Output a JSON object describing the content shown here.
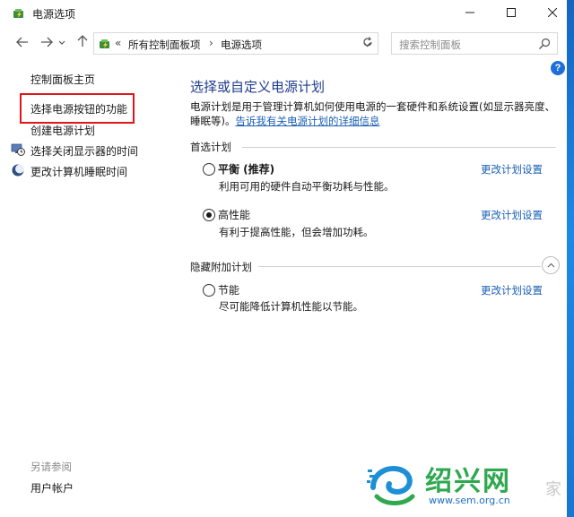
{
  "window": {
    "title": "电源选项",
    "minimize_icon": "minimize-icon",
    "maximize_icon": "maximize-icon",
    "close_icon": "close-icon"
  },
  "navigation": {
    "back_icon": "arrow-left-icon",
    "forward_icon": "arrow-right-icon",
    "recent_icon": "chevron-down-icon",
    "up_icon": "arrow-up-icon",
    "address": {
      "separator": "«",
      "crumbs": [
        "所有控制面板项",
        "电源选项"
      ],
      "crumb_separator": "›"
    },
    "refresh_icon": "refresh-icon",
    "search": {
      "placeholder": "搜索控制面板"
    }
  },
  "help_label": "?",
  "sidebar": {
    "home": "控制面板主页",
    "items": [
      {
        "label": "选择电源按钮的功能",
        "highlighted": true
      },
      {
        "label": "创建电源计划"
      },
      {
        "label": "选择关闭显示器的时间",
        "icon": "display-clock-icon"
      },
      {
        "label": "更改计算机睡眠时间",
        "icon": "moon-icon"
      }
    ],
    "see_also": "另请参阅",
    "user_accounts": "用户帐户"
  },
  "main": {
    "title": "选择或自定义电源计划",
    "description": "电源计划是用于管理计算机如何使用电源的一套硬件和系统设置(如显示器亮度、睡眠等)。",
    "description_link": "告诉我有关电源计划的详细信息",
    "preferred_label": "首选计划",
    "hidden_label": "隐藏附加计划",
    "plans": [
      {
        "name": "平衡 (推荐)",
        "description": "利用可用的硬件自动平衡功耗与性能。",
        "link": "更改计划设置",
        "selected": false
      },
      {
        "name": "高性能",
        "description": "有利于提高性能，但会增加功耗。",
        "link": "更改计划设置",
        "selected": true
      },
      {
        "name": "节能",
        "description": "尽可能降低计算机性能以节能。",
        "link": "更改计划设置",
        "selected": false
      }
    ]
  },
  "watermark": {
    "title": "绍兴网",
    "url": "www.sem.org.cn",
    "suffix": "家"
  },
  "colors": {
    "title_blue": "#1e3d8c",
    "link_blue": "#1a5fb4",
    "highlight_red": "#e01616",
    "help_blue": "#1e6fd9"
  }
}
